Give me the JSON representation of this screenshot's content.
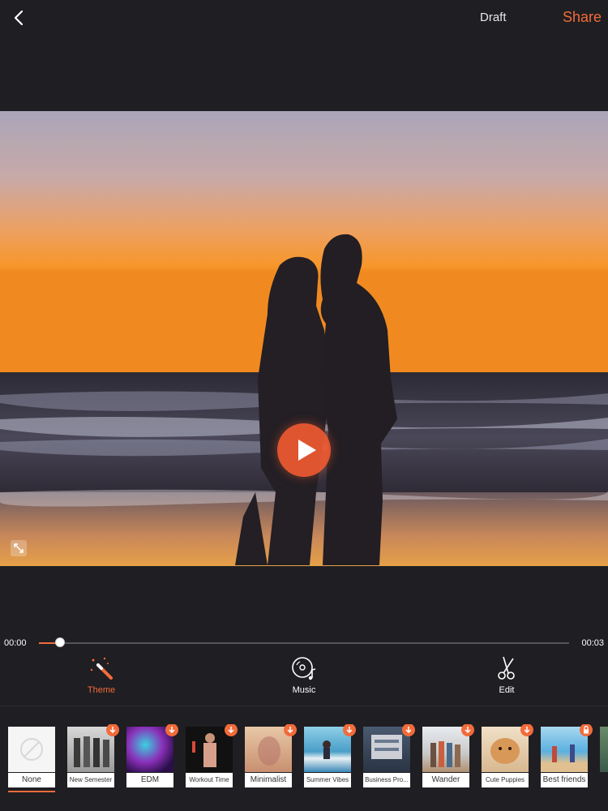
{
  "header": {
    "back_icon": "chevron-left-icon",
    "draft_label": "Draft",
    "share_label": "Share"
  },
  "player": {
    "current_time": "00:00",
    "total_time": "00:03",
    "progress": 0.04
  },
  "tools": [
    {
      "label": "Theme",
      "icon": "magic-wand-icon",
      "active": true
    },
    {
      "label": "Music",
      "icon": "music-disc-icon",
      "active": false
    },
    {
      "label": "Edit",
      "icon": "scissors-icon",
      "active": false
    }
  ],
  "themes": [
    {
      "label": "None",
      "badge": "none",
      "selected": true
    },
    {
      "label": "New Semester",
      "badge": "download"
    },
    {
      "label": "EDM",
      "badge": "download"
    },
    {
      "label": "Workout Time",
      "badge": "download"
    },
    {
      "label": "Minimalist",
      "badge": "download"
    },
    {
      "label": "Summer Vibes",
      "badge": "download"
    },
    {
      "label": "Business Pro...",
      "badge": "download"
    },
    {
      "label": "Wander",
      "badge": "download"
    },
    {
      "label": "Cute Puppies",
      "badge": "download"
    },
    {
      "label": "Best friends",
      "badge": "lock"
    }
  ],
  "colors": {
    "accent": "#f26b3a",
    "background": "#1f1e22"
  }
}
